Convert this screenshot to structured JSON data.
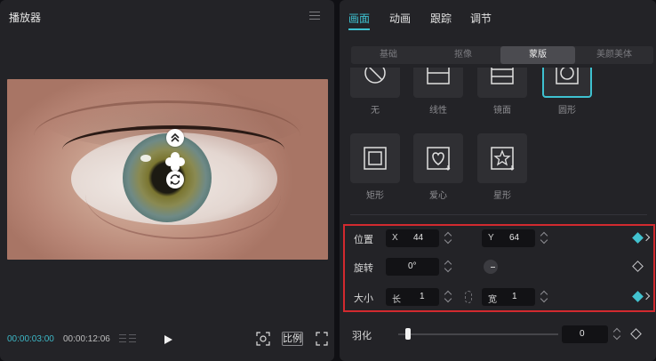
{
  "player": {
    "title": "播放器",
    "time_current": "00:00:03:00",
    "time_total": "00:00:12:06",
    "ratio_label": "比例",
    "icons": [
      "menu-icon",
      "move-up-icon",
      "move-icon",
      "rotate-icon",
      "grid-icon",
      "play-icon",
      "fit-screen-icon",
      "fullscreen-icon"
    ]
  },
  "inspector": {
    "tabs": [
      {
        "label": "画面",
        "active": true
      },
      {
        "label": "动画",
        "active": false
      },
      {
        "label": "跟踪",
        "active": false
      },
      {
        "label": "调节",
        "active": false
      }
    ],
    "sub_tabs": [
      {
        "label": "基础",
        "active": false
      },
      {
        "label": "抠像",
        "active": false
      },
      {
        "label": "蒙版",
        "active": true
      },
      {
        "label": "美颜美体",
        "active": false
      }
    ],
    "masks": [
      {
        "label": "无",
        "icon": "no-mask-icon",
        "selected": false
      },
      {
        "label": "线性",
        "icon": "linear-mask-icon",
        "selected": false
      },
      {
        "label": "镜面",
        "icon": "mirror-mask-icon",
        "selected": false
      },
      {
        "label": "圆形",
        "icon": "circle-mask-icon",
        "selected": true
      },
      {
        "label": "矩形",
        "icon": "rectangle-mask-icon",
        "selected": false
      },
      {
        "label": "爱心",
        "icon": "heart-mask-icon",
        "selected": false
      },
      {
        "label": "星形",
        "icon": "star-mask-icon",
        "selected": false
      }
    ],
    "position": {
      "label": "位置",
      "x_axis": "X",
      "x": "44",
      "y_axis": "Y",
      "y": "64",
      "keyframe": true
    },
    "rotation": {
      "label": "旋转",
      "value": "0°",
      "keyframe": false
    },
    "size": {
      "label": "大小",
      "w_axis": "长",
      "w": "1",
      "h_axis": "宽",
      "h": "1",
      "keyframe": true
    },
    "feather": {
      "label": "羽化",
      "value": "0",
      "level": 0,
      "keyframe": false
    },
    "accent_color": "#3ec1d0",
    "highlight_color": "#d22a2f"
  }
}
